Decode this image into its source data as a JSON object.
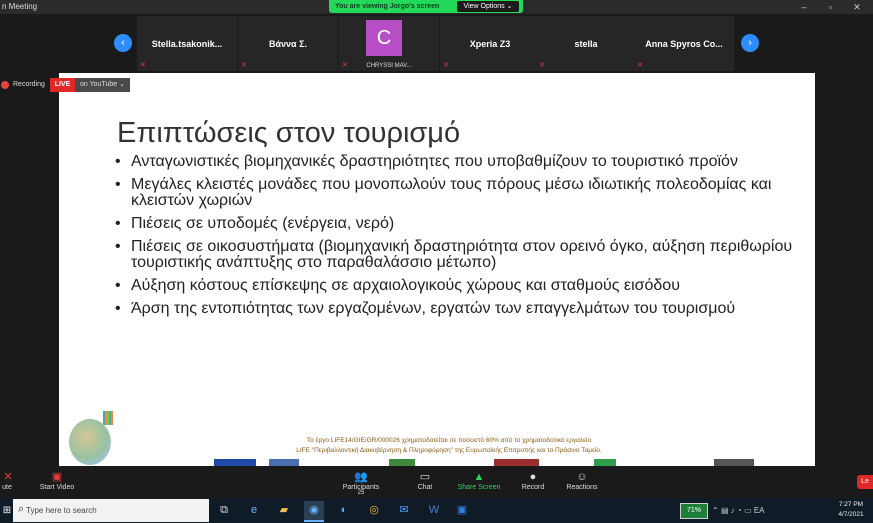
{
  "window": {
    "title": "n Meeting",
    "controls": [
      "–",
      "▫",
      "✕"
    ]
  },
  "share_banner": {
    "message": "You are viewing Jorgo's screen",
    "view_options_label": "View Options ⌄"
  },
  "participants": {
    "prev_icon": "‹",
    "next_icon": "›",
    "tiles": [
      {
        "name": "Stella.tsakonik...",
        "muted": true
      },
      {
        "name": "Βάννα Σ.",
        "muted": true
      },
      {
        "name": "",
        "avatar_letter": "C",
        "subtitle": "CHRYSSI MAV...",
        "avatar_color": "#b84ec6",
        "muted": true
      },
      {
        "name": "Xperia Z3",
        "muted": true
      },
      {
        "name": "stella",
        "muted": true
      },
      {
        "name": "Anna Spyros Co...",
        "muted": true
      }
    ]
  },
  "recording": {
    "label": "Recording",
    "live": "LIVE",
    "platform": "on YouTube ⌄"
  },
  "slide": {
    "title": "Επιπτώσεις στον τουρισμό",
    "bullets": [
      "Ανταγωνιστικές βιομηχανικές δραστηριότητες που υποβαθμίζουν το τουριστικό προϊόν",
      "Μεγάλες κλειστές μονάδες που μονοπωλούν τους πόρους μέσω ιδιωτικής πολεοδομίας και κλειστών χωριών",
      "Πιέσεις σε υποδομές (ενέργεια, νερό)",
      "Πιέσεις σε οικοσυστήματα (βιομηχανική δραστηριότητα στον ορεινό όγκο, αύξηση περιθωρίου τουριστικής ανάπτυξης στο παραθαλάσσιο μέτωπο)",
      "Αύξηση κόστους επίσκεψης σε αρχαιολογικούς χώρους και σταθμούς εισόδου",
      "Άρση της εντοπιότητας των εργαζομένων, εργατών των επαγγελμάτων του τουρισμού"
    ],
    "funding_line1": "Το έργο LIFE14/GIE/GR/000026 χρηματοδοτείται σε ποσοστό 60% από το χρηματοδοτικό εργαλείο",
    "funding_line2": "LIFE \"Περιβαλλοντική Διακυβέρνηση & Πληροφόρηση\" της Ευρωπαϊκής Επιτροπής και το Πράσινο Ταμείο."
  },
  "controls": {
    "mute": "ute",
    "start_video": "Start Video",
    "participants": "Participants",
    "participants_count": "25",
    "chat": "Chat",
    "share_screen": "Share Screen",
    "record": "Record",
    "reactions": "Reactions",
    "leave": "Le"
  },
  "taskbar": {
    "search_placeholder": "Type here to search",
    "battery": "71%",
    "lang": "EA",
    "time": "7:27 PM",
    "date": "4/7/2021"
  },
  "colors": {
    "accent_blue": "#2d8cff",
    "banner_green": "#23d959",
    "live_red": "#e02828",
    "share_green": "#23d959"
  }
}
